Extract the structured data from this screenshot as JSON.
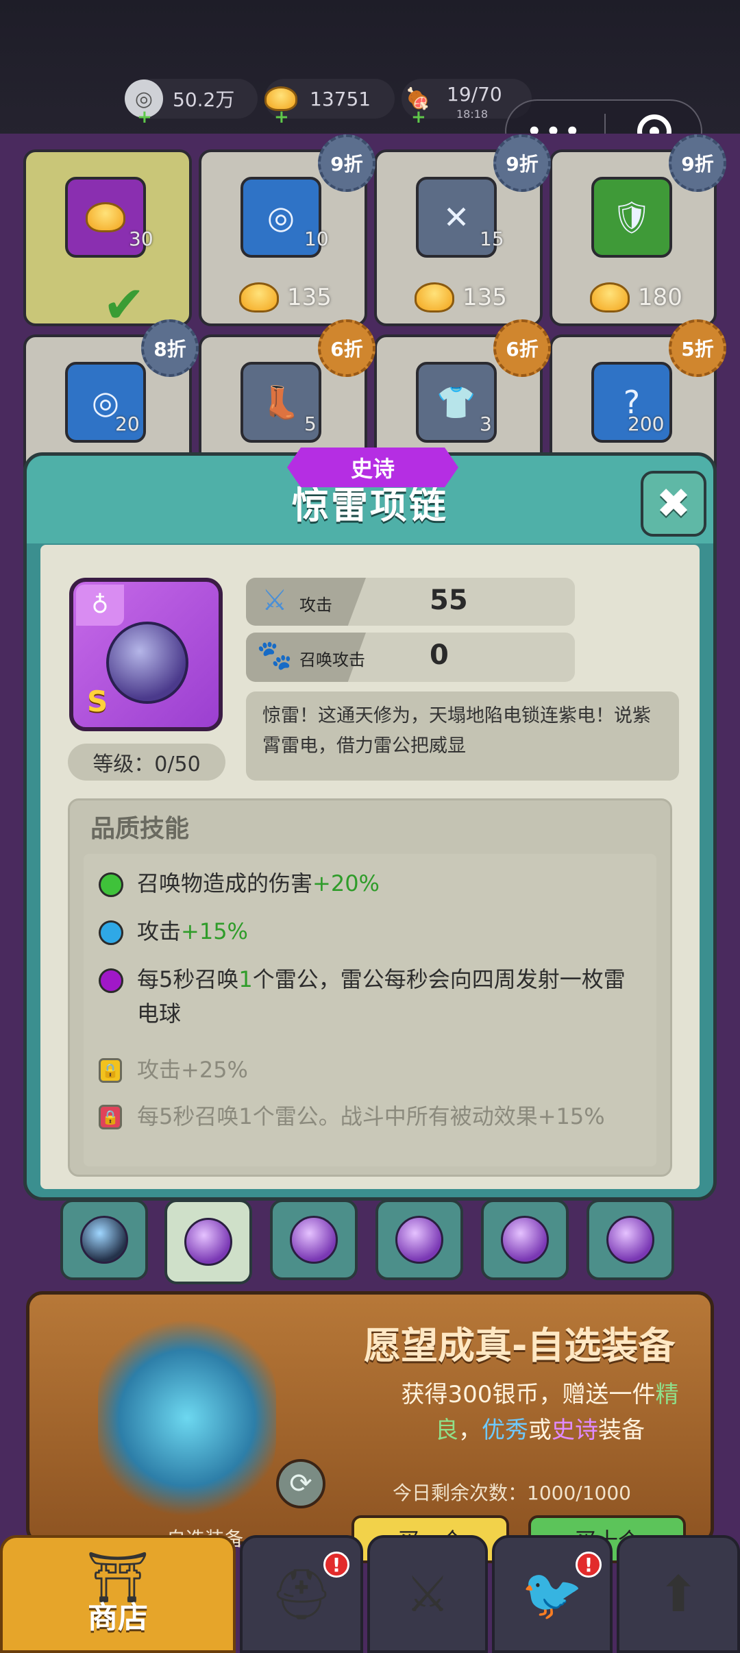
{
  "resources": [
    {
      "name": "silver-coin",
      "value": "50.2万",
      "sub": ""
    },
    {
      "name": "gold-ingot",
      "value": "13751",
      "sub": ""
    },
    {
      "name": "stamina-meat",
      "value": "19/70",
      "sub": "18:18"
    }
  ],
  "shop": {
    "cells": [
      {
        "count": "30",
        "price": "",
        "discount": "",
        "purchased": true,
        "icon": "gold-ingot-icon",
        "color": "#8a2fb0"
      },
      {
        "count": "10",
        "price": "135",
        "discount": "9折",
        "icon": "silver-coin-icon",
        "color": "#2f73c6"
      },
      {
        "count": "15",
        "price": "135",
        "discount": "9折",
        "icon": "sword-crystal-icon",
        "color": "#5c6c86"
      },
      {
        "count": "",
        "price": "180",
        "discount": "9折",
        "icon": "armor-icon",
        "color": "#3f9a38"
      },
      {
        "count": "20",
        "price": "",
        "discount": "8折",
        "icon": "silver-coin-icon",
        "color": "#2f73c6"
      },
      {
        "count": "5",
        "price": "",
        "discount": "6折",
        "icon": "boot-crystal-icon",
        "color": "#5c6c86"
      },
      {
        "count": "3",
        "price": "",
        "discount": "6折",
        "icon": "armor-crystal-icon",
        "color": "#5c6c86"
      },
      {
        "count": "200",
        "price": "",
        "discount": "5折",
        "icon": "mystery-crystal-icon",
        "color": "#5c6c86"
      }
    ]
  },
  "modal": {
    "rarity": "史诗",
    "title": "惊雷项链",
    "close_icon": "✖",
    "grade": "S",
    "level": "等级：0/50",
    "stats": [
      {
        "label": "攻击",
        "value": "55",
        "icon": "sword-icon"
      },
      {
        "label": "召唤攻击",
        "value": "0",
        "icon": "paw-icon"
      }
    ],
    "description": "惊雷！这通天修为，天塌地陷电锁连紫电！说紫霄雷电，借力雷公把威显",
    "skills_title": "品质技能",
    "skills": [
      {
        "text": "召唤物造成的伤害",
        "bonus": "+20%",
        "dot_color": "#3fc23a",
        "locked": false
      },
      {
        "text": "攻击",
        "bonus": "+15%",
        "dot_color": "#2fa8e6",
        "locked": false
      },
      {
        "text_before": "每5秒召唤",
        "highlight": "1",
        "text_after": "个雷公，雷公每秒会向四周发射一枚雷电球",
        "dot_color": "#a018c8",
        "locked": false
      },
      {
        "text": "攻击+25%",
        "lock_color": "#f2c21e",
        "locked": true
      },
      {
        "text": "每5秒召唤1个雷公。战斗中所有被动效果+15%",
        "lock_color": "#e0435a",
        "locked": true
      }
    ]
  },
  "tabs": [
    {
      "name": "tab-item-1",
      "active": false
    },
    {
      "name": "tab-item-2",
      "active": true
    },
    {
      "name": "tab-item-3",
      "active": false
    },
    {
      "name": "tab-item-4",
      "active": false
    },
    {
      "name": "tab-item-5",
      "active": false
    },
    {
      "name": "tab-item-6",
      "active": false
    }
  ],
  "promo": {
    "title": "愿望成真-自选装备",
    "line1": "获得300银币，赠送一件",
    "q1": "精",
    "q1b": "良",
    "sep1": "，",
    "q2": "优秀",
    "or": "或",
    "q3": "史诗",
    "tail": "装备",
    "remaining": "今日剩余次数：1000/1000",
    "buy_one": "买一个",
    "buy_ten": "买十个",
    "sub_label": "自选装备"
  },
  "nav": {
    "shop_label": "商店"
  },
  "colors": {
    "accent_teal": "#4fb0a8",
    "epic_purple": "#b52ee3",
    "bonus_green": "#2f9c2a"
  }
}
